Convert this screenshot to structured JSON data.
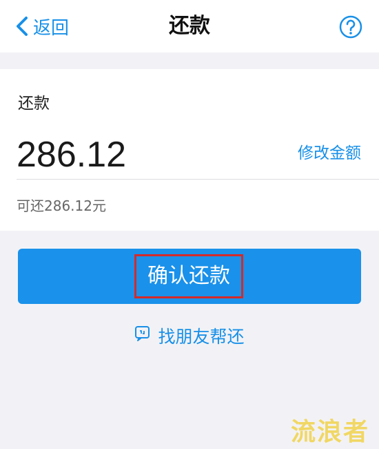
{
  "nav": {
    "back_label": "返回",
    "title": "还款",
    "help_icon": "question-circle-icon"
  },
  "card": {
    "label": "还款",
    "amount": "286.12",
    "modify_label": "修改金额",
    "available_text": "可还286.12元"
  },
  "actions": {
    "confirm_label": "确认还款",
    "friend_label": "找朋友帮还",
    "friend_icon": "chat-bubble-icon"
  },
  "watermark": "流浪者",
  "colors": {
    "accent": "#1890e8",
    "button": "#1a91ea",
    "highlight_box": "#d32a2a",
    "background": "#f2f2f6"
  }
}
